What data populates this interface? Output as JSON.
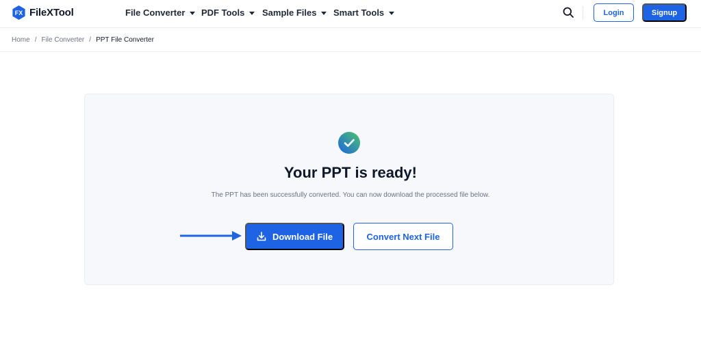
{
  "brand": {
    "name": "FileXTool",
    "mark_text": "FX",
    "color": "#1d63e4"
  },
  "nav": [
    {
      "label": "File Converter"
    },
    {
      "label": "PDF Tools"
    },
    {
      "label": "Sample Files"
    },
    {
      "label": "Smart Tools"
    }
  ],
  "header": {
    "login_label": "Login",
    "signup_label": "Signup"
  },
  "breadcrumb": {
    "items": [
      "Home",
      "File Converter"
    ],
    "current": "PPT File Converter"
  },
  "result": {
    "title": "Your PPT is ready!",
    "subtitle": "The PPT has been successfully converted. You can now download the processed file below.",
    "download_label": "Download File",
    "convert_next_label": "Convert Next File"
  },
  "colors": {
    "accent": "#1d63e4",
    "success_gradient": [
      "#1d63e4",
      "#4cc46a"
    ]
  },
  "icons": {
    "search": "search-icon",
    "check": "check-circle-icon",
    "download": "download-icon",
    "arrow": "arrow-right-icon"
  }
}
